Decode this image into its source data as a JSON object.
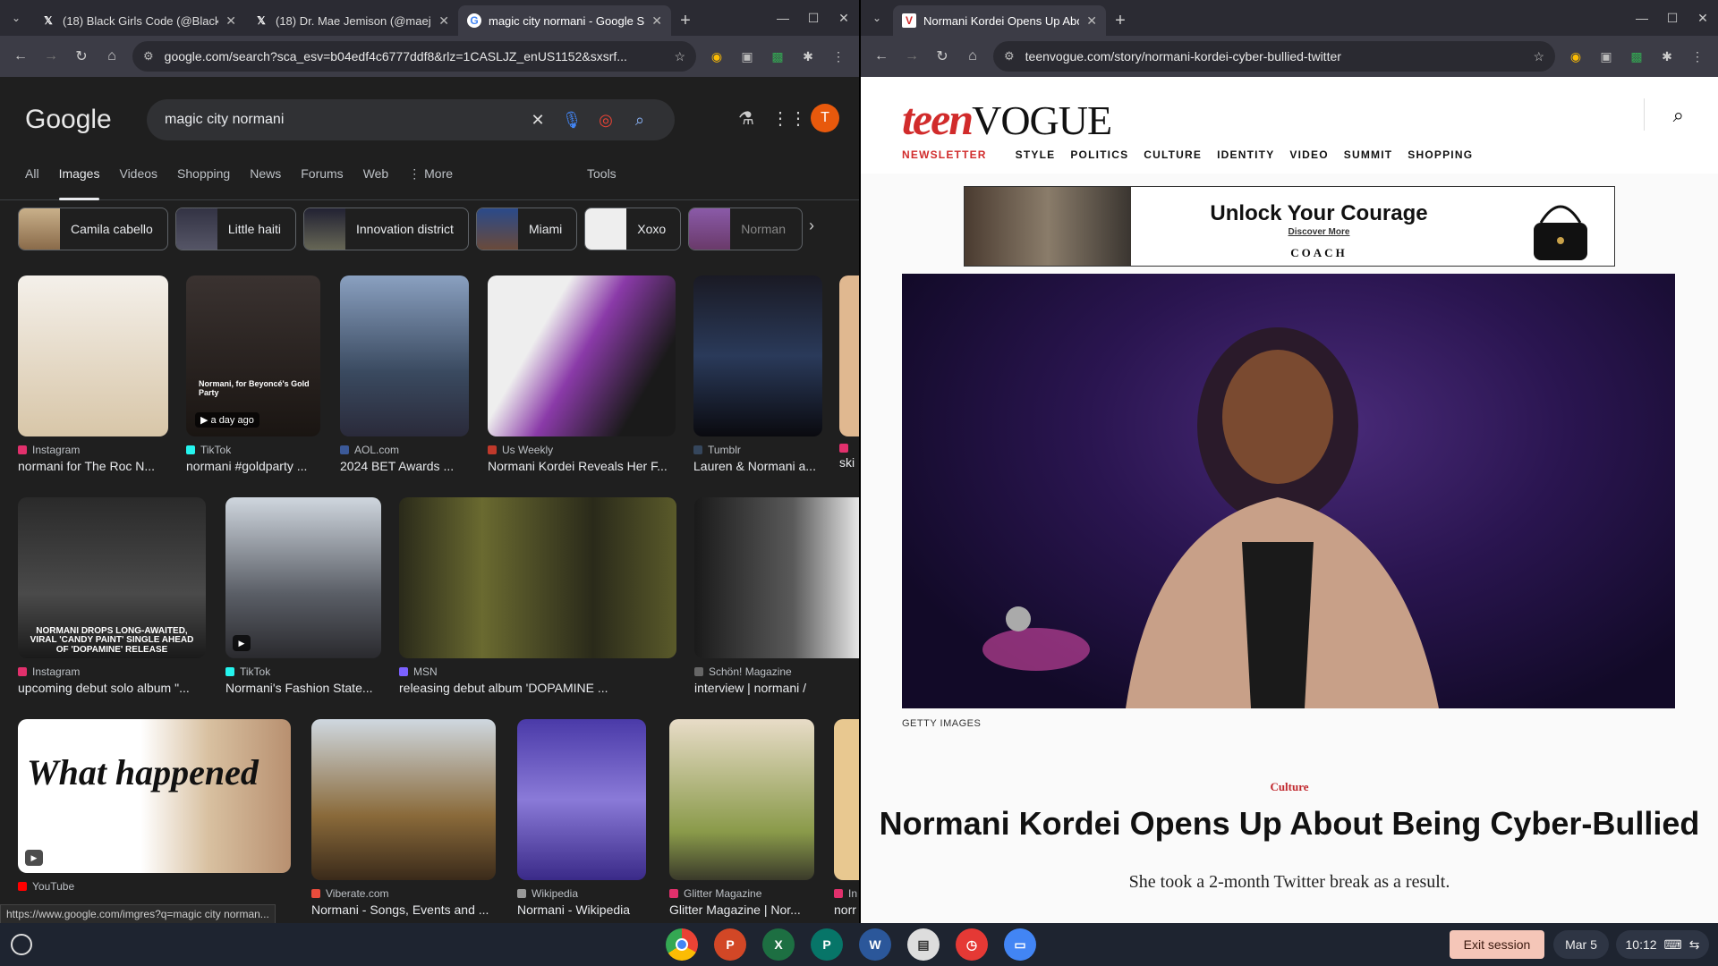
{
  "left_browser": {
    "tabs": [
      {
        "title": "(18) Black Girls Code (@BlackG",
        "icon": "x-logo-icon"
      },
      {
        "title": "(18) Dr. Mae Jemison (@maeje",
        "icon": "x-logo-icon"
      },
      {
        "title": "magic city normani - Google Se",
        "icon": "google-icon",
        "active": true
      }
    ],
    "url": "google.com/search?sca_esv=b04edf4c6777ddf8&rlz=1CASLJZ_enUS1152&sxsrf...",
    "logo": "Google",
    "query": "magic city normani",
    "avatar_letter": "T",
    "nav_tabs": [
      "All",
      "Images",
      "Videos",
      "Shopping",
      "News",
      "Forums",
      "Web",
      "More"
    ],
    "active_tab": "Images",
    "tools": "Tools",
    "chips": [
      "Camila cabello",
      "Little haiti",
      "Innovation district",
      "Miami",
      "Xoxo",
      "Norman"
    ],
    "row1": [
      {
        "source": "Instagram",
        "title": "normani for The Roc N...",
        "color": "#e1306c"
      },
      {
        "source": "TikTok",
        "title": "normani #goldparty ...",
        "color": "#25f4ee",
        "badge": "a day ago",
        "caption": "Normani, for Beyoncé's Gold Party"
      },
      {
        "source": "AOL.com",
        "title": "2024 BET Awards ...",
        "color": "#3b5998"
      },
      {
        "source": "Us Weekly",
        "title": "Normani Kordei Reveals Her F...",
        "color": "#c0392b"
      },
      {
        "source": "Tumblr",
        "title": "Lauren & Normani a...",
        "color": "#35465c"
      },
      {
        "source": "",
        "title": "ski",
        "color": "#e1306c"
      }
    ],
    "row2": [
      {
        "source": "Instagram",
        "title": "upcoming debut solo album \"...",
        "color": "#e1306c",
        "caption": "NORMANI DROPS LONG-AWAITED, VIRAL 'CANDY PAINT' SINGLE AHEAD OF 'DOPAMINE' RELEASE"
      },
      {
        "source": "TikTok",
        "title": "Normani's Fashion State...",
        "color": "#25f4ee"
      },
      {
        "source": "MSN",
        "title": "releasing debut album 'DOPAMINE ...",
        "color": "#7b61ff"
      },
      {
        "source": "Schön! Magazine",
        "title": "interview | normani /",
        "color": "#666"
      }
    ],
    "row3": [
      {
        "source": "YouTube",
        "title": "",
        "color": "#ff0000",
        "caption": "What happened"
      },
      {
        "source": "Viberate.com",
        "title": "Normani - Songs, Events and ...",
        "color": "#e74c3c"
      },
      {
        "source": "Wikipedia",
        "title": "Normani - Wikipedia",
        "color": "#999"
      },
      {
        "source": "Glitter Magazine",
        "title": "Glitter Magazine | Nor...",
        "color": "#e1306c"
      },
      {
        "source": "In",
        "title": "norr",
        "color": "#e1306c"
      }
    ],
    "status_url": "https://www.google.com/imgres?q=magic city norman..."
  },
  "right_browser": {
    "tab_title": "Normani Kordei Opens Up Abo",
    "url": "teenvogue.com/story/normani-kordei-cyber-bullied-twitter",
    "logo_teen": "teen",
    "logo_vogue": "VOGUE",
    "nav": [
      "NEWSLETTER",
      "STYLE",
      "POLITICS",
      "CULTURE",
      "IDENTITY",
      "VIDEO",
      "SUMMIT",
      "SHOPPING"
    ],
    "ad": {
      "headline": "Unlock Your Courage",
      "sub": "Discover More",
      "brand": "COACH"
    },
    "photo_credit": "GETTY IMAGES",
    "category": "Culture",
    "headline": "Normani Kordei Opens Up About Being Cyber-Bullied",
    "dek": "She took a 2-month Twitter break as a result."
  },
  "shelf": {
    "exit": "Exit session",
    "date": "Mar 5",
    "time": "10:12"
  }
}
